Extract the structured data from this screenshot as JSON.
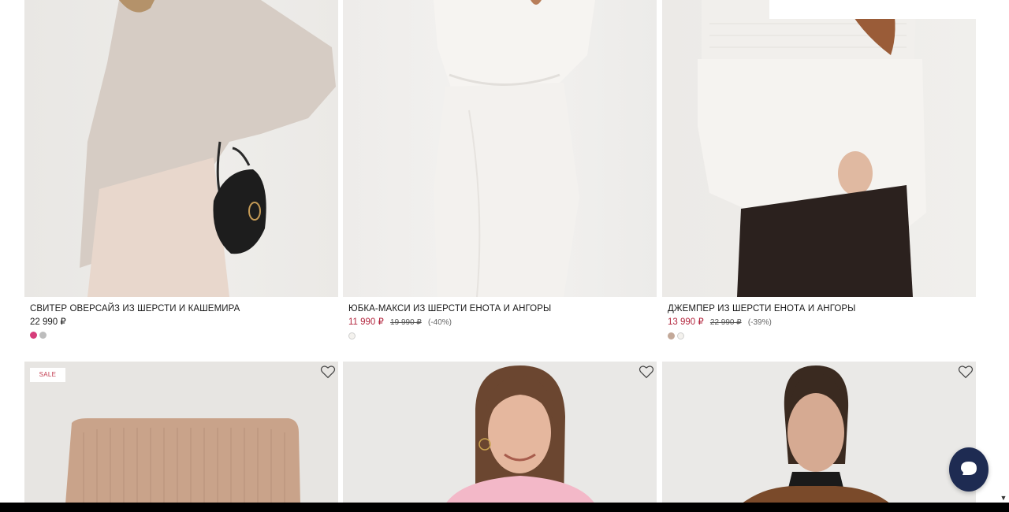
{
  "products": [
    {
      "title": "СВИТЕР ОВЕРСАЙЗ ИЗ ШЕРСТИ И КАШЕМИРА",
      "price": "22 990 ₽",
      "old_price": "",
      "discount": "",
      "swatches": [
        "#d63d7a",
        "#bdbdbd"
      ]
    },
    {
      "title": "ЮБКА-МАКСИ ИЗ ШЕРСТИ ЕНОТА И АНГОРЫ",
      "price": "11 990 ₽",
      "old_price": "19 990 ₽",
      "discount": "(-40%)",
      "swatches": [
        "#f4f2ee"
      ]
    },
    {
      "title": "ДЖЕМПЕР ИЗ ШЕРСТИ ЕНОТА И АНГОРЫ",
      "price": "13 990 ₽",
      "old_price": "22 990 ₽",
      "discount": "(-39%)",
      "swatches": [
        "#c3a999",
        "#f4f2ee"
      ]
    }
  ],
  "row2": {
    "sale_badge": "SALE"
  },
  "icons": {
    "favorite": "heart-outline-icon",
    "chat": "chat-bubble-icon",
    "scroll": "scroll-down-arrow-icon"
  },
  "colors": {
    "sale_price": "#b3263e",
    "chat_button": "#1e2b52"
  }
}
